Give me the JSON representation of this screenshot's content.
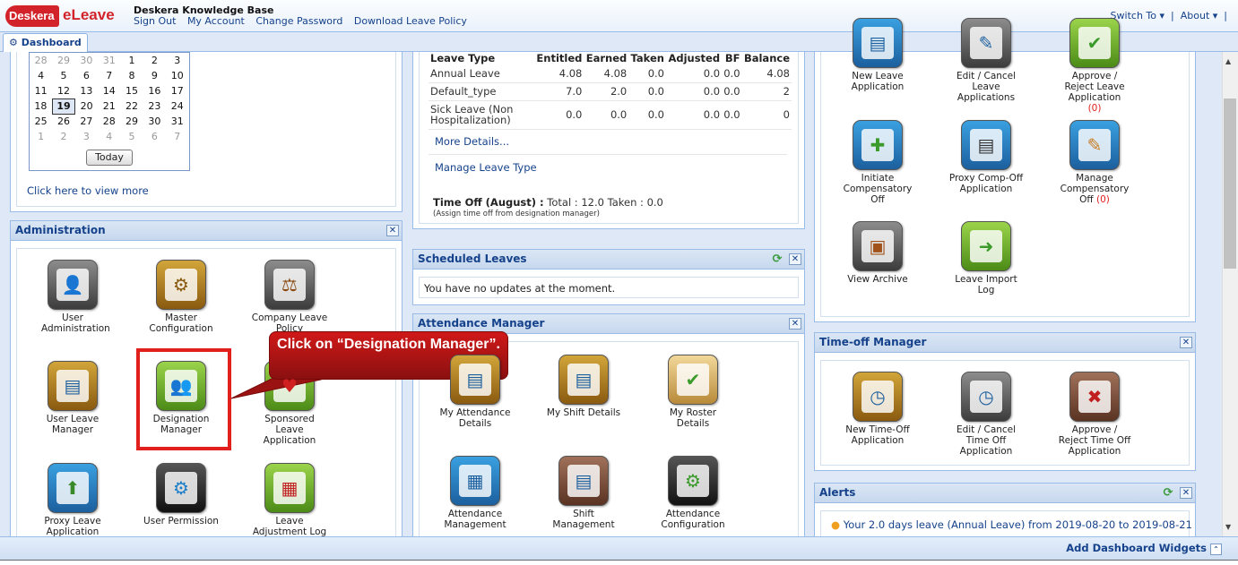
{
  "header": {
    "logo_badge": "Deskera",
    "logo_text": "eLeave",
    "app_title": "Deskera Knowledge Base",
    "links": [
      "Sign Out",
      "My Account",
      "Change Password",
      "Download Leave Policy"
    ],
    "switch_to": "Switch To",
    "about": "About"
  },
  "tab": {
    "label": "Dashboard"
  },
  "calendar": {
    "rows": [
      [
        "28",
        "29",
        "30",
        "31",
        "1",
        "2",
        "3"
      ],
      [
        "4",
        "5",
        "6",
        "7",
        "8",
        "9",
        "10"
      ],
      [
        "11",
        "12",
        "13",
        "14",
        "15",
        "16",
        "17"
      ],
      [
        "18",
        "19",
        "20",
        "21",
        "22",
        "23",
        "24"
      ],
      [
        "25",
        "26",
        "27",
        "28",
        "29",
        "30",
        "31"
      ],
      [
        "1",
        "2",
        "3",
        "4",
        "5",
        "6",
        "7"
      ]
    ],
    "today_day": "19",
    "today_button": "Today",
    "view_more": "Click here to view more"
  },
  "administration": {
    "title": "Administration",
    "items": [
      {
        "label": "User Administration",
        "icon": "user-admin-icon"
      },
      {
        "label": "Master Configuration",
        "icon": "gear-icon"
      },
      {
        "label": "Company Leave Policy",
        "icon": "gavel-icon"
      },
      {
        "label": "User Leave Manager",
        "icon": "user-leave-icon"
      },
      {
        "label": "Designation Manager",
        "icon": "designation-icon"
      },
      {
        "label": "Sponsored Leave Application",
        "icon": "sponsored-icon"
      },
      {
        "label": "Proxy Leave Application",
        "icon": "proxy-upload-icon"
      },
      {
        "label": "User Permission",
        "icon": "permission-gear-icon"
      },
      {
        "label": "Leave Adjustment Log",
        "icon": "log-icon"
      }
    ]
  },
  "leave_table": {
    "headers": [
      "Leave Type",
      "Entitled",
      "Earned",
      "Taken",
      "Adjusted",
      "BF",
      "Balance"
    ],
    "rows": [
      [
        "Annual Leave",
        "4.08",
        "4.08",
        "0.0",
        "0.0",
        "0.0",
        "4.08"
      ],
      [
        "Default_type",
        "7.0",
        "2.0",
        "0.0",
        "0.0",
        "0.0",
        "2"
      ],
      [
        "Sick Leave (Non Hospitalization)",
        "0.0",
        "0.0",
        "0.0",
        "0.0",
        "0.0",
        "0"
      ]
    ],
    "more_details": "More Details...",
    "manage_type": "Manage Leave Type",
    "time_off_label": "Time Off (August) :",
    "time_off_values": "Total : 12.0 Taken : 0.0",
    "time_off_note": "(Assign time off from designation manager)"
  },
  "scheduled": {
    "title": "Scheduled Leaves",
    "message": "You have no updates at the moment."
  },
  "attendance": {
    "title": "Attendance Manager",
    "items": [
      {
        "label": "My Attendance Details",
        "icon": "attendance-icon"
      },
      {
        "label": "My Shift Details",
        "icon": "shift-icon"
      },
      {
        "label": "My Roster Details",
        "icon": "roster-icon"
      },
      {
        "label": "Attendance Management",
        "icon": "calendar-icon"
      },
      {
        "label": "Shift Management",
        "icon": "shift-mgmt-icon"
      },
      {
        "label": "Attendance Configuration",
        "icon": "config-icon"
      }
    ]
  },
  "leave_apps": {
    "items": [
      {
        "label": "New Leave Application",
        "count": ""
      },
      {
        "label": "Edit / Cancel Leave Applications",
        "count": ""
      },
      {
        "label": "Approve / Reject Leave Application",
        "count": "(0)"
      },
      {
        "label": "Initiate Compensatory Off",
        "count": ""
      },
      {
        "label": "Proxy Comp-Off Application",
        "count": ""
      },
      {
        "label": "Manage Compensatory Off",
        "count": "(0)"
      },
      {
        "label": "View Archive",
        "count": ""
      },
      {
        "label": "Leave Import Log",
        "count": ""
      }
    ]
  },
  "timeoff": {
    "title": "Time-off Manager",
    "items": [
      {
        "label": "New Time-Off Application"
      },
      {
        "label": "Edit / Cancel Time Off Application"
      },
      {
        "label": "Approve / Reject Time Off Application"
      }
    ]
  },
  "alerts": {
    "title": "Alerts",
    "message": "Your 2.0 days leave (Annual Leave) from 2019-08-20 to 2019-08-21"
  },
  "callout": {
    "text": "Click on “Designation Manager”."
  },
  "footer": {
    "add_widgets": "Add Dashboard Widgets"
  },
  "colors": {
    "accent": "#15428b",
    "panel_header": "#c7d8ee",
    "highlight": "#e1201e",
    "callout": "#b01414"
  }
}
